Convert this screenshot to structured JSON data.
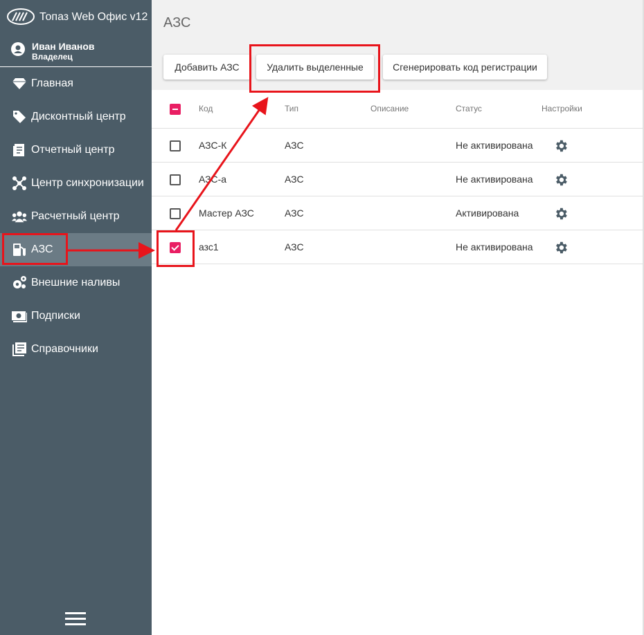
{
  "app": {
    "title": "Топаз Web Офис v12"
  },
  "user": {
    "name": "Иван Иванов",
    "role": "Владелец"
  },
  "sidebar": {
    "items": [
      {
        "label": "Главная",
        "icon": "diamond-icon"
      },
      {
        "label": "Дисконтный центр",
        "icon": "tag-icon"
      },
      {
        "label": "Отчетный центр",
        "icon": "report-icon"
      },
      {
        "label": "Центр синхронизации",
        "icon": "sync-network-icon"
      },
      {
        "label": "Расчетный центр",
        "icon": "users-icon"
      },
      {
        "label": "АЗС",
        "icon": "gas-station-icon",
        "active": true
      },
      {
        "label": "Внешние наливы",
        "icon": "cogs-icon"
      },
      {
        "label": "Подписки",
        "icon": "money-icon"
      },
      {
        "label": "Справочники",
        "icon": "book-icon"
      }
    ]
  },
  "main": {
    "title": "АЗС",
    "buttons": {
      "add": "Добавить АЗС",
      "delete": "Удалить выделенные",
      "generate": "Сгенерировать код регистрации"
    },
    "table": {
      "headers": {
        "code": "Код",
        "type": "Тип",
        "description": "Описание",
        "status": "Статус",
        "settings": "Настройки"
      },
      "rows": [
        {
          "code": "АЗС-К",
          "type": "АЗС",
          "description": "",
          "status": "Не активирована",
          "checked": false
        },
        {
          "code": "АЗС-а",
          "type": "АЗС",
          "description": "",
          "status": "Не активирована",
          "checked": false
        },
        {
          "code": "Мастер АЗС",
          "type": "АЗС",
          "description": "",
          "status": "Активирована",
          "checked": false
        },
        {
          "code": "азс1",
          "type": "АЗС",
          "description": "",
          "status": "Не активирована",
          "checked": true
        }
      ]
    }
  },
  "colors": {
    "sidebar_bg": "#4b5c67",
    "sidebar_active": "#6b7b85",
    "accent": "#e91e63",
    "annotation": "#e8141b"
  }
}
